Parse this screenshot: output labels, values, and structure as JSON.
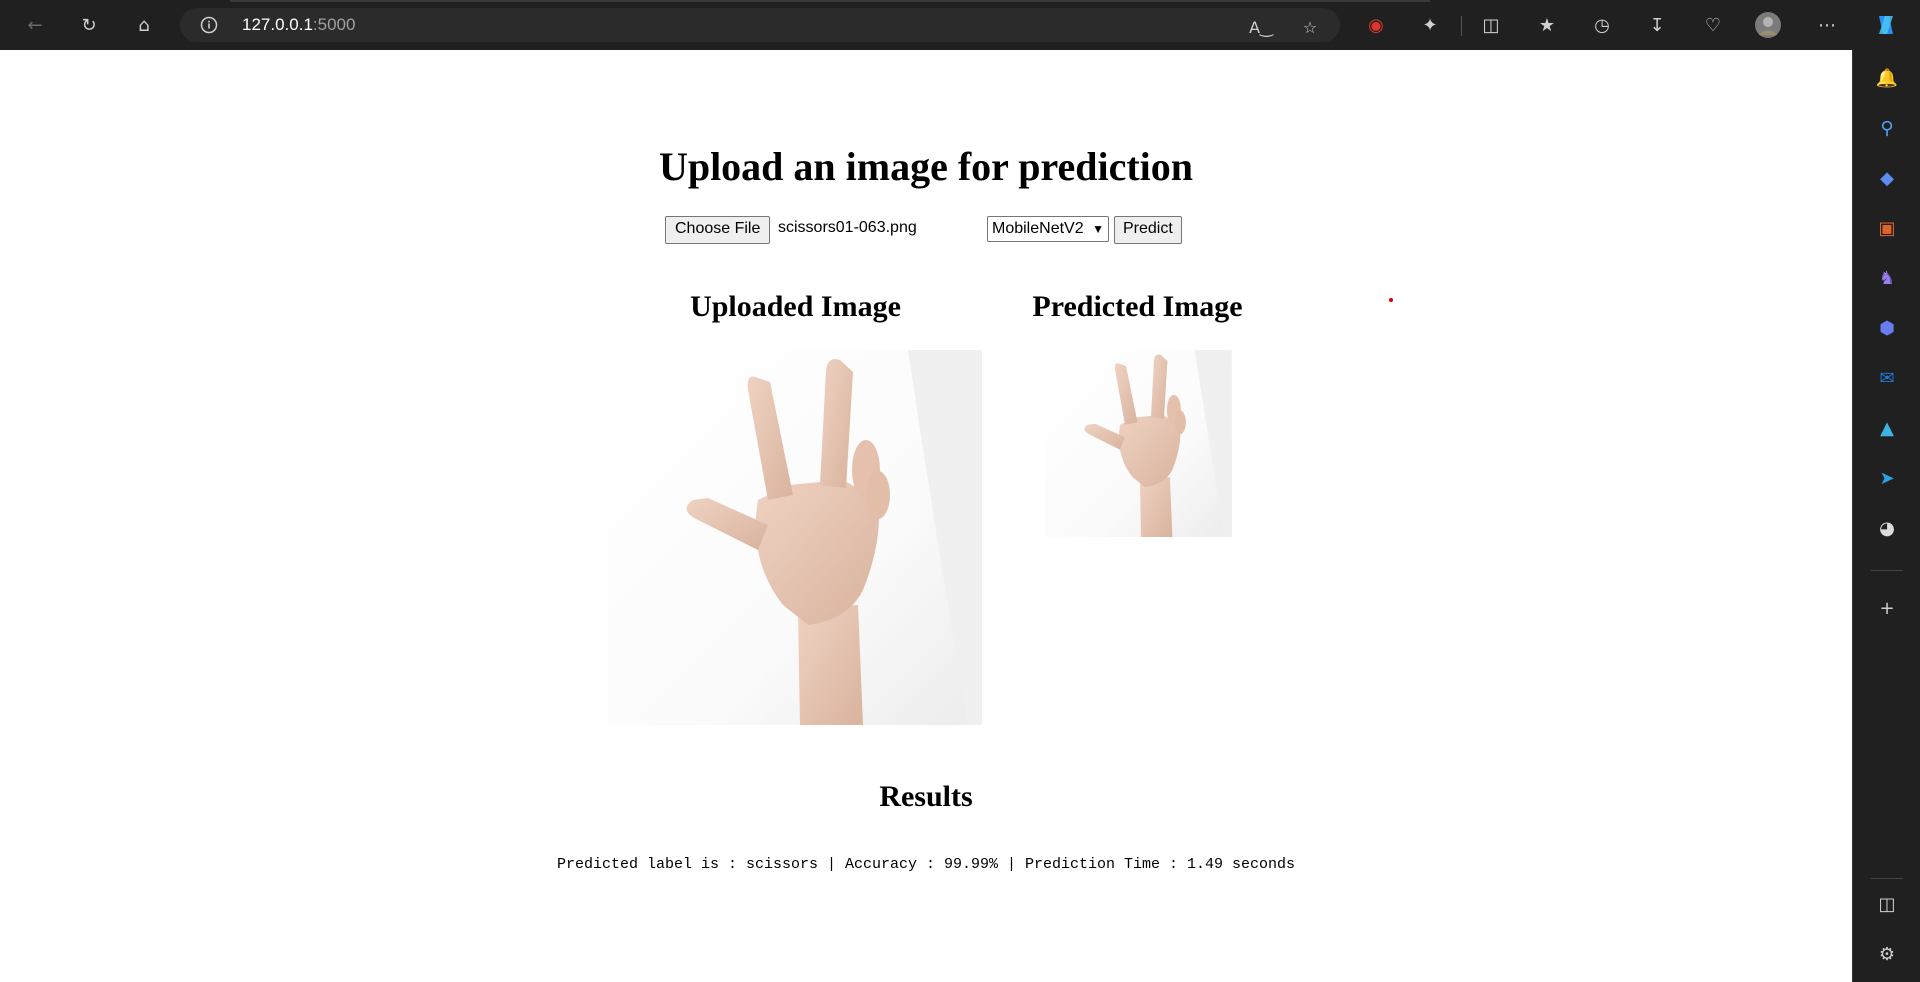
{
  "browser": {
    "url_host": "127.0.0.1",
    "url_port": ":5000",
    "colors": {
      "chrome": "#202020",
      "address": "#2b2b2b"
    },
    "icons": [
      "back-icon",
      "refresh-icon",
      "home-icon",
      "info-icon",
      "read-aloud-icon",
      "favorite-star-icon",
      "tracking-icon",
      "extensions-icon",
      "split-screen-icon",
      "favorites-icon",
      "history-icon",
      "downloads-icon",
      "browser-essentials-icon",
      "profile-avatar",
      "more-icon",
      "copilot-icon"
    ]
  },
  "sidebar": {
    "icons": [
      "bell-icon",
      "search-icon",
      "tag-icon",
      "toolbox-icon",
      "chess-icon",
      "m365-icon",
      "outlook-icon",
      "send-icon",
      "telegram-icon",
      "speedometer-icon",
      "add-icon",
      "sidebar-toggle-icon",
      "settings-icon"
    ]
  },
  "page": {
    "title": "Upload an image for prediction",
    "choose_file_label": "Choose File",
    "file_name": "scissors01-063.png",
    "model_selected": "MobileNetV2",
    "predict_label": "Predict",
    "uploaded_heading": "Uploaded Image",
    "predicted_heading": "Predicted Image",
    "results_heading": "Results",
    "result_text": "Predicted label is : scissors | Accuracy : 99.99% | Prediction Time : 1.49 seconds"
  }
}
